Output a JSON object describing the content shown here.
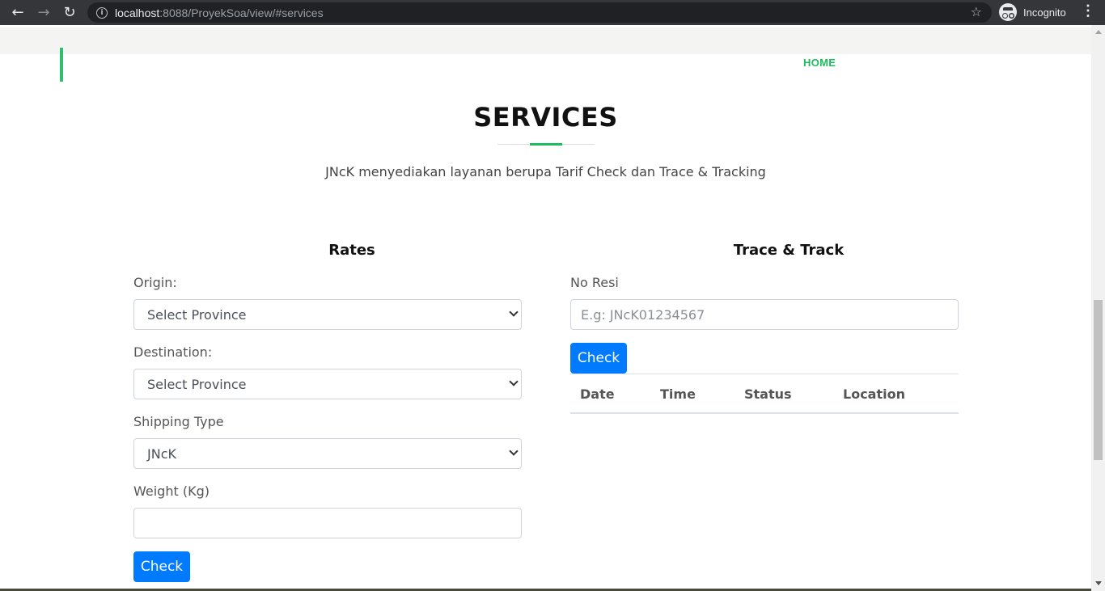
{
  "browser": {
    "url_host": "localhost",
    "url_rest": ":8088/ProyekSoa/view/#services",
    "profile_label": "Incognito"
  },
  "nav": {
    "home_label": "HOME"
  },
  "section": {
    "title": "SERVICES",
    "subtitle": "JNcK menyediakan layanan berupa Tarif Check dan Trace & Tracking"
  },
  "rates": {
    "title": "Rates",
    "origin_label": "Origin:",
    "origin_value": "Select Province",
    "destination_label": "Destination:",
    "destination_value": "Select Province",
    "shipping_label": "Shipping Type",
    "shipping_value": "JNcK",
    "weight_label": "Weight (Kg)",
    "weight_value": "",
    "check_label": "Check"
  },
  "trace": {
    "title": "Trace & Track",
    "resi_label": "No Resi",
    "resi_placeholder": "E.g: JNcK01234567",
    "check_label": "Check",
    "columns": [
      "Date",
      "Time",
      "Status",
      "Location"
    ]
  },
  "colors": {
    "accent_green": "#1bbd5e",
    "button_blue": "#007bff"
  }
}
